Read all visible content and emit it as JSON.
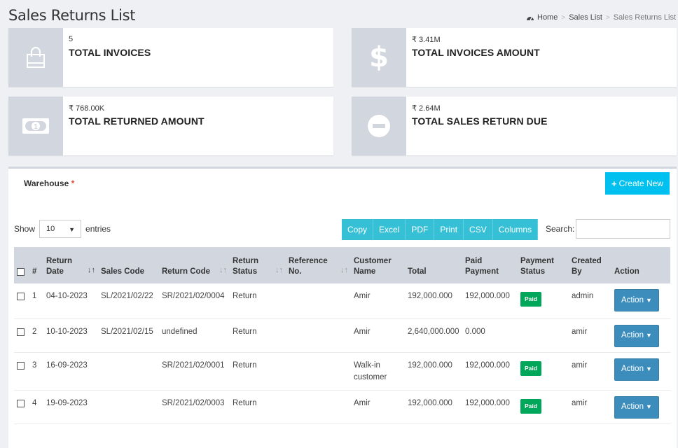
{
  "header": {
    "title": "Sales Returns List",
    "breadcrumb": {
      "home": "Home",
      "parent": "Sales List",
      "current": "Sales Returns List"
    }
  },
  "stats": [
    {
      "value": "5",
      "label": "TOTAL INVOICES",
      "icon": "shopping-bag-icon"
    },
    {
      "value": "₹ 3.41M",
      "label": "TOTAL INVOICES AMOUNT",
      "icon": "dollar-icon"
    },
    {
      "value": "₹ 768.00K",
      "label": "TOTAL RETURNED AMOUNT",
      "icon": "money-bill-icon"
    },
    {
      "value": "₹ 2.64M",
      "label": "TOTAL SALES RETURN DUE",
      "icon": "minus-circle-icon"
    }
  ],
  "filters": {
    "warehouse_label": "Warehouse",
    "required_mark": "*"
  },
  "toolbar": {
    "create_label": "Create New",
    "show_label": "Show",
    "entries_value": "10",
    "entries_label": "entries",
    "export_buttons": [
      "Copy",
      "Excel",
      "PDF",
      "Print",
      "CSV",
      "Columns"
    ],
    "search_label": "Search:"
  },
  "table": {
    "headers": {
      "num": "#",
      "return_date": [
        "Return",
        "Date"
      ],
      "sales_code": "Sales Code",
      "return_code": "Return Code",
      "return_status": [
        "Return",
        "Status"
      ],
      "reference": [
        "Reference",
        "No."
      ],
      "customer": [
        "Customer",
        "Name"
      ],
      "total": "Total",
      "paid": [
        "Paid",
        "Payment"
      ],
      "payment_status": [
        "Payment",
        "Status"
      ],
      "created_by": [
        "Created",
        "By"
      ],
      "action": "Action"
    },
    "rows": [
      {
        "num": "1",
        "date": "04-10-2023",
        "sales_code": "SL/2021/02/22",
        "return_code": "SR/2021/02/0004",
        "status": "Return",
        "reference": "",
        "customer": "Amir",
        "total": "192,000.000",
        "paid": "192,000.000",
        "payment_status": "Paid",
        "created_by": "admin",
        "action": "Action"
      },
      {
        "num": "2",
        "date": "10-10-2023",
        "sales_code": "SL/2021/02/15",
        "return_code": "undefined",
        "status": "Return",
        "reference": "",
        "customer": "Amir",
        "total": "2,640,000.000",
        "paid": "0.000",
        "payment_status": "",
        "created_by": "amir",
        "action": "Action"
      },
      {
        "num": "3",
        "date": "16-09-2023",
        "sales_code": "",
        "return_code": "SR/2021/02/0001",
        "status": "Return",
        "reference": "",
        "customer": "Walk-in customer",
        "total": "192,000.000",
        "paid": "192,000.000",
        "payment_status": "Paid",
        "created_by": "amir",
        "action": "Action"
      },
      {
        "num": "4",
        "date": "19-09-2023",
        "sales_code": "",
        "return_code": "SR/2021/02/0003",
        "status": "Return",
        "reference": "",
        "customer": "Amir",
        "total": "192,000.000",
        "paid": "192,000.000",
        "payment_status": "Paid",
        "created_by": "amir",
        "action": "Action"
      }
    ]
  },
  "colors": {
    "accent": "#00c0ef",
    "export": "#35c0d6",
    "primary": "#3c8dbc",
    "success": "#00a65a",
    "icon_bg": "#d2d6de"
  }
}
